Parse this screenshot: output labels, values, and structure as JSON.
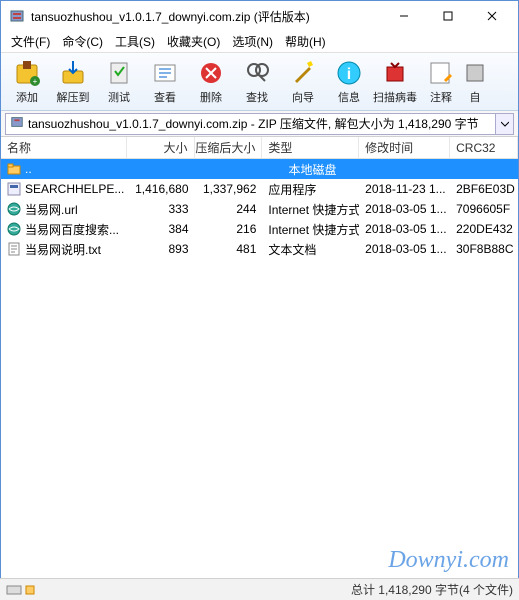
{
  "window": {
    "title": "tansuozhushou_v1.0.1.7_downyi.com.zip (评估版本)"
  },
  "menu": {
    "file": "文件(F)",
    "commands": "命令(C)",
    "tools": "工具(S)",
    "favorites": "收藏夹(O)",
    "options": "选项(N)",
    "help": "帮助(H)"
  },
  "toolbar": {
    "add": "添加",
    "extract": "解压到",
    "test": "测试",
    "view": "查看",
    "delete": "删除",
    "find": "查找",
    "wizard": "向导",
    "info": "信息",
    "virus": "扫描病毒",
    "comment": "注释",
    "sfx": "自"
  },
  "pathbar": {
    "text": "tansuozhushou_v1.0.1.7_downyi.com.zip - ZIP 压缩文件, 解包大小为 1,418,290 字节"
  },
  "columns": {
    "name": "名称",
    "size": "大小",
    "packed": "压缩后大小",
    "type": "类型",
    "modified": "修改时间",
    "crc32": "CRC32"
  },
  "updir": {
    "label": "..",
    "type": "本地磁盘"
  },
  "files": [
    {
      "icon": "exe",
      "name": "SEARCHHELPE...",
      "size": "1,416,680",
      "packed": "1,337,962",
      "type": "应用程序",
      "modified": "2018-11-23 1...",
      "crc": "2BF6E03D"
    },
    {
      "icon": "url",
      "name": "当易网.url",
      "size": "333",
      "packed": "244",
      "type": "Internet 快捷方式",
      "modified": "2018-03-05 1...",
      "crc": "7096605F"
    },
    {
      "icon": "url",
      "name": "当易网百度搜索...",
      "size": "384",
      "packed": "216",
      "type": "Internet 快捷方式",
      "modified": "2018-03-05 1...",
      "crc": "220DE432"
    },
    {
      "icon": "txt",
      "name": "当易网说明.txt",
      "size": "893",
      "packed": "481",
      "type": "文本文档",
      "modified": "2018-03-05 1...",
      "crc": "30F8B88C"
    }
  ],
  "status": {
    "summary": "总计 1,418,290 字节(4 个文件)"
  },
  "watermark": "Downyi.com"
}
